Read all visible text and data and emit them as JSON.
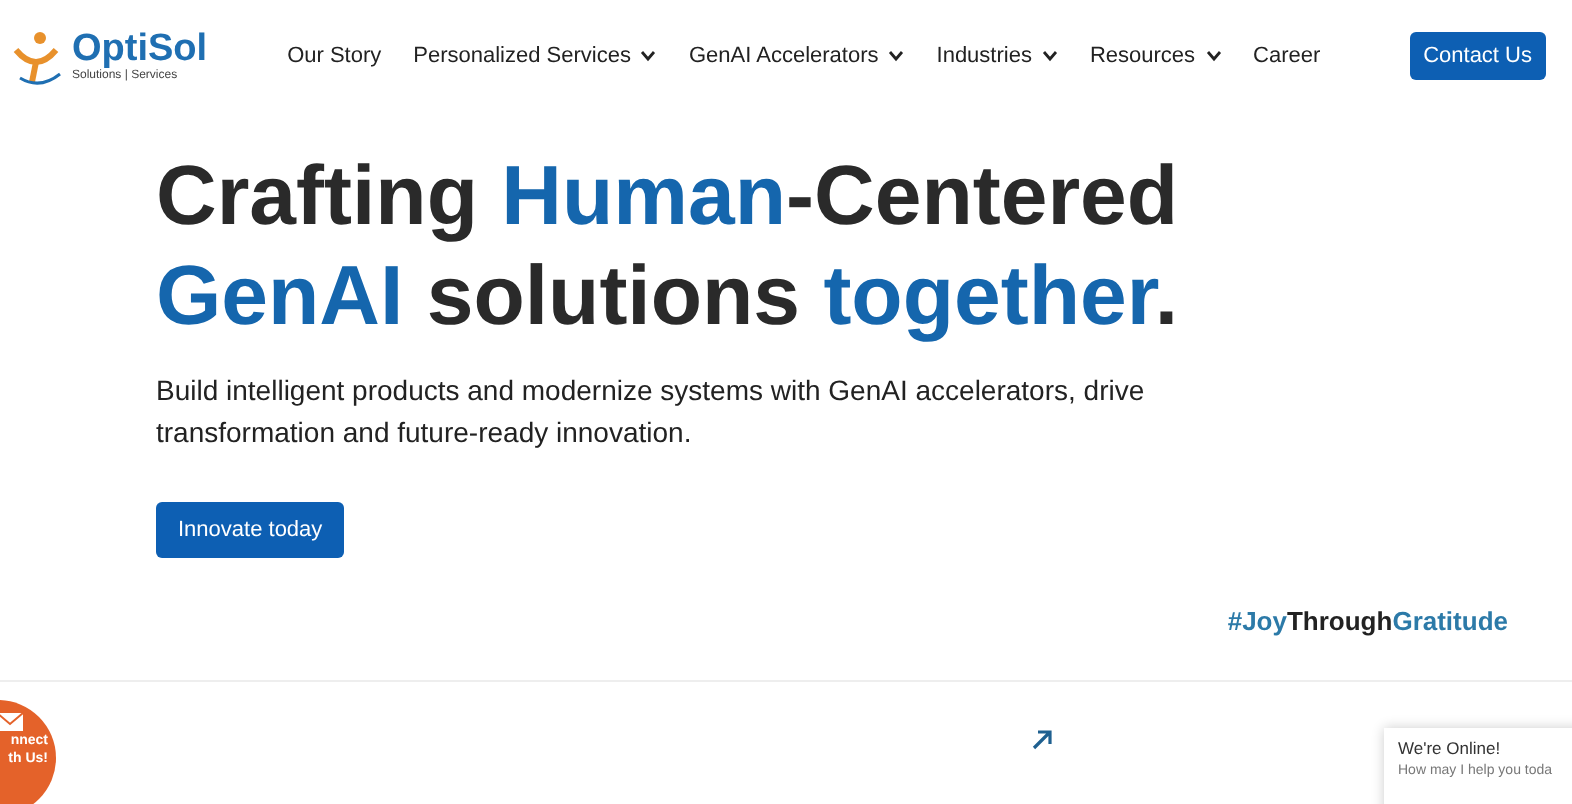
{
  "header": {
    "logo": {
      "name": "OptiSol",
      "tagline": "Solutions | Services"
    },
    "nav": [
      {
        "label": "Our Story",
        "dropdown": false
      },
      {
        "label": "Personalized Services",
        "dropdown": true
      },
      {
        "label": "GenAI Accelerators",
        "dropdown": true
      },
      {
        "label": "Industries",
        "dropdown": true
      },
      {
        "label": "Resources",
        "dropdown": true
      },
      {
        "label": "Career",
        "dropdown": false
      }
    ],
    "cta": "Contact Us"
  },
  "hero": {
    "headline": [
      [
        {
          "text": "Crafting ",
          "highlight": false
        },
        {
          "text": "Human",
          "highlight": true
        },
        {
          "text": "-Centered",
          "highlight": false
        }
      ],
      [
        {
          "text": "GenAI",
          "highlight": true
        },
        {
          "text": " solutions ",
          "highlight": false
        },
        {
          "text": "together",
          "highlight": true
        },
        {
          "text": ".",
          "highlight": false
        }
      ]
    ],
    "description": "Build intelligent products and modernize systems with GenAI accelerators, drive transformation and future-ready innovation.",
    "button": "Innovate today",
    "hashtag": [
      {
        "text": "#Joy",
        "highlight": true
      },
      {
        "text": "Through",
        "highlight": false
      },
      {
        "text": "Gratitude",
        "highlight": true
      }
    ]
  },
  "connect_badge": [
    "nnect",
    "th Us!"
  ],
  "chat_widget": {
    "title": "We're Online!",
    "message": "How may I help you toda"
  }
}
